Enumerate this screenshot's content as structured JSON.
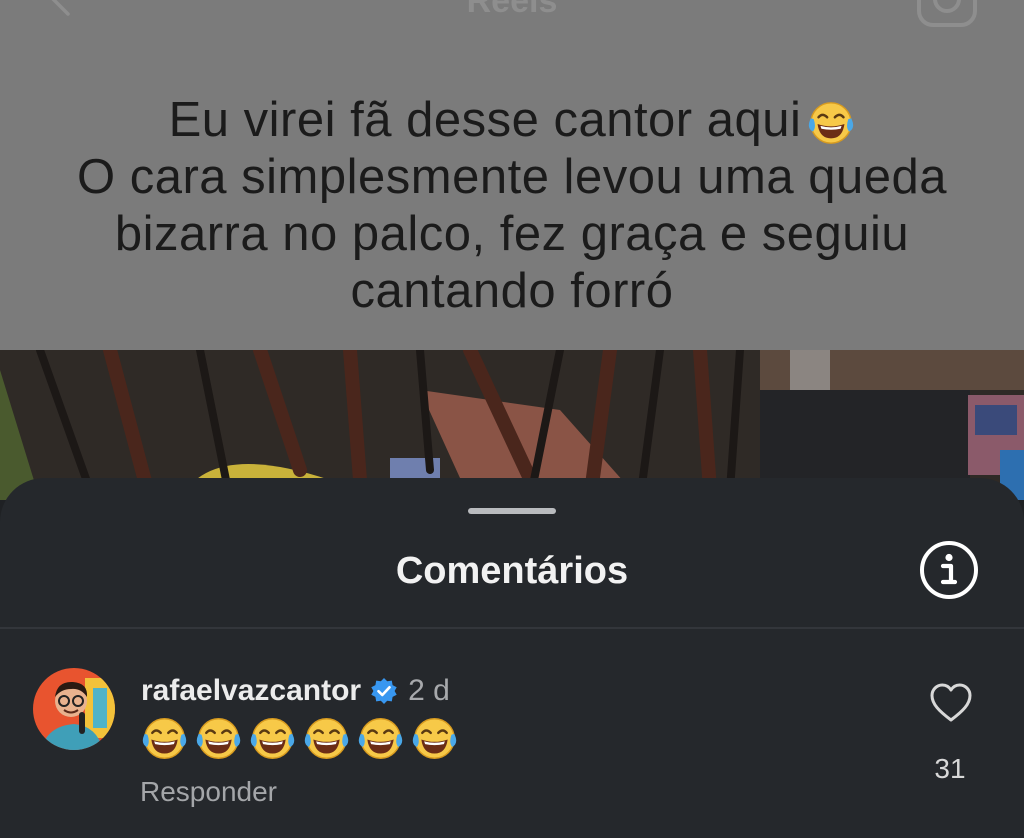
{
  "header": {
    "title": "Reels",
    "back_icon": "back-arrow-icon",
    "camera_icon": "camera-icon"
  },
  "caption": {
    "lines": [
      "Eu virei fã desse cantor aqui",
      "O cara simplesmente levou uma queda",
      "bizarra no palco, fez graça e seguiu",
      "cantando forró"
    ],
    "emoji": "face-with-tears-of-joy"
  },
  "comments_sheet": {
    "title": "Comentários",
    "info_icon": "info-icon",
    "comments": [
      {
        "username": "rafaelvazcantor",
        "verified": true,
        "time": "2 d",
        "emoji_count": 6,
        "emoji": "face-with-tears-of-joy",
        "reply_label": "Responder",
        "likes": "31"
      }
    ]
  },
  "colors": {
    "sheet_background": "#25282c",
    "caption_background": "#7b7b7b",
    "verified_blue": "#3897f0",
    "emoji_yellow": "#f7c948"
  }
}
